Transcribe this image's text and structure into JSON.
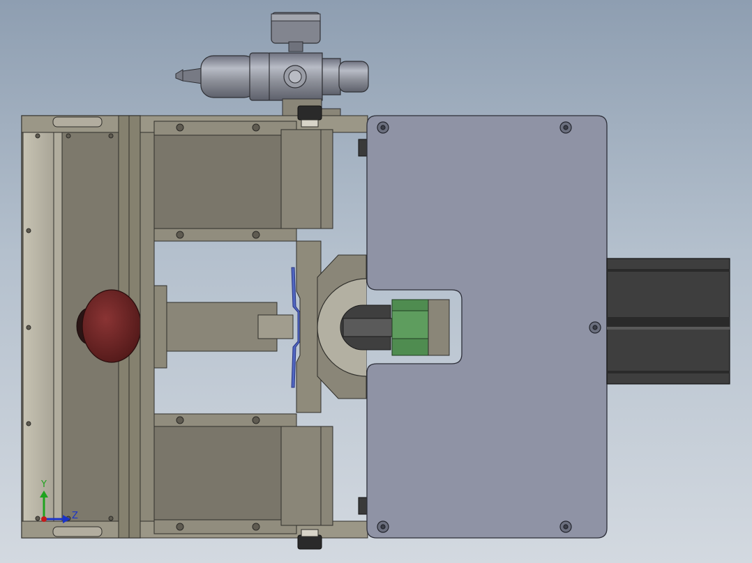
{
  "viewport": {
    "background_top": "#8e9eb1",
    "background_bottom": "#d3d9e0"
  },
  "model": {
    "part_colors": {
      "steel": "#7b776e",
      "steel_dark": "#5e5a53",
      "steel_light": "#a29d92",
      "panel": "#8f93a5",
      "emergency_button": "#6d2424",
      "green_block": "#4f8c50",
      "blue_plate": "#4a5fb4",
      "profile": "#3e3e3e",
      "regulator": "#8d9099"
    }
  },
  "triad": {
    "y_label": "Y",
    "z_label": "Z",
    "y_color": "#1fa31f",
    "z_color": "#1a33c8",
    "x_color": "#c41a1a"
  }
}
